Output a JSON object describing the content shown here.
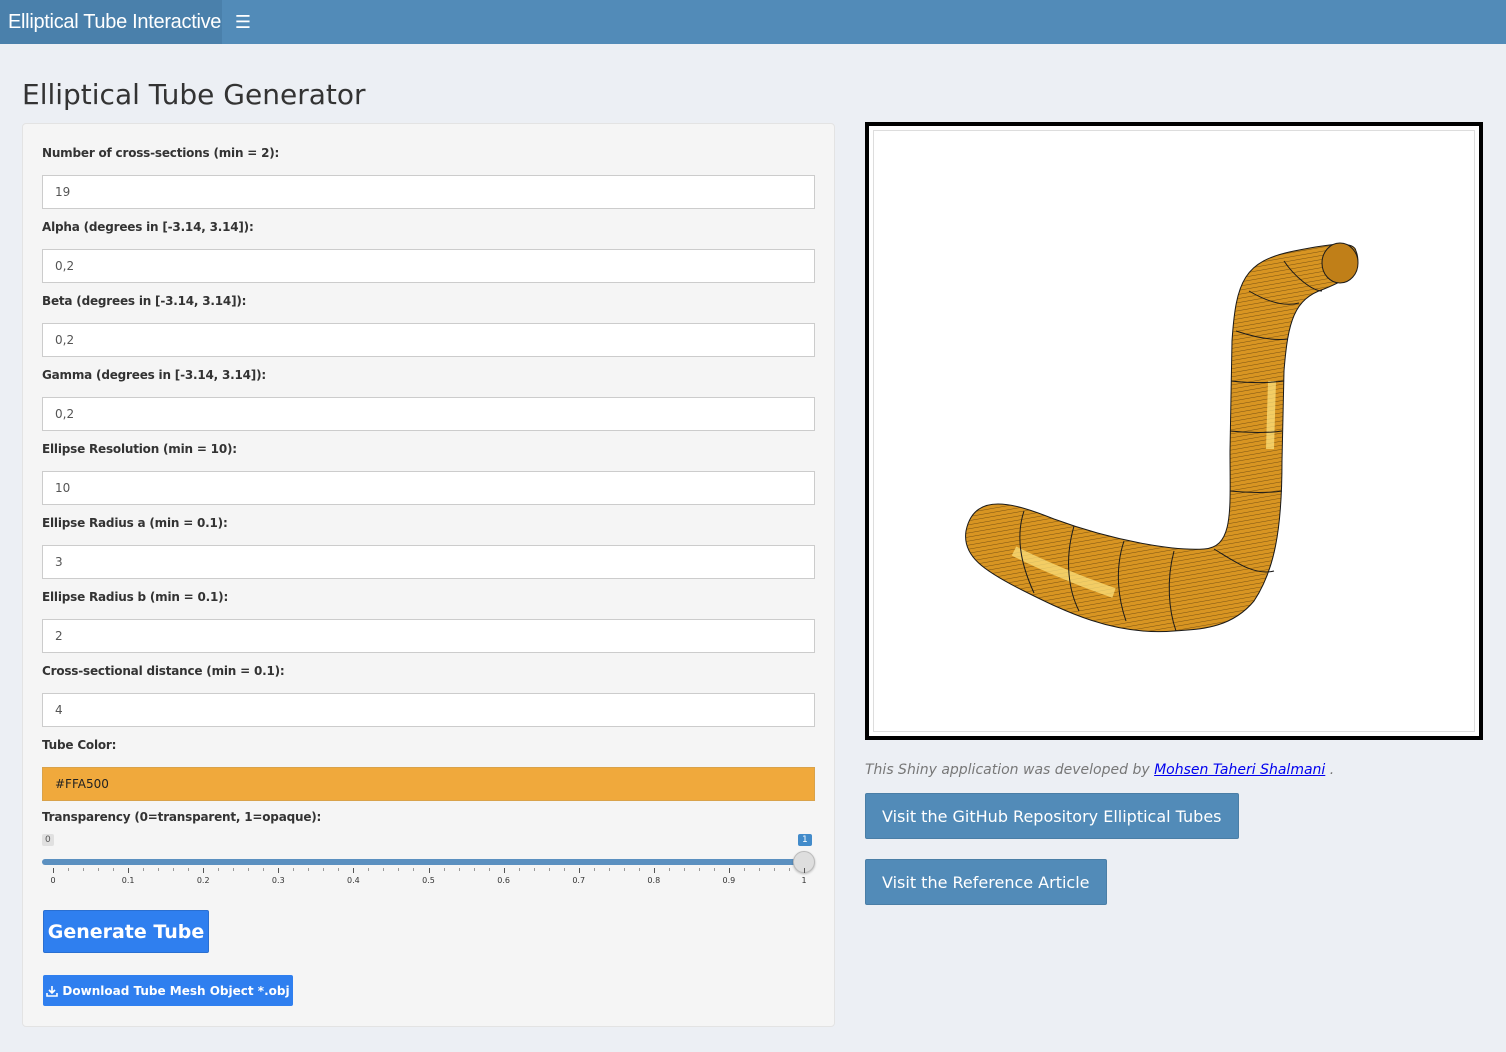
{
  "navbar": {
    "brand": "Elliptical Tube Interactive",
    "menu_icon": "hamburger-icon"
  },
  "page": {
    "title": "Elliptical Tube Generator"
  },
  "form": {
    "fields": [
      {
        "label": "Number of cross-sections (min = 2):",
        "value": "19"
      },
      {
        "label": "Alpha (degrees in [-3.14, 3.14]):",
        "value": "0,2"
      },
      {
        "label": "Beta (degrees in [-3.14, 3.14]):",
        "value": "0,2"
      },
      {
        "label": "Gamma (degrees in [-3.14, 3.14]):",
        "value": "0,2"
      },
      {
        "label": "Ellipse Resolution (min = 10):",
        "value": "10"
      },
      {
        "label": "Ellipse Radius a (min = 0.1):",
        "value": "3"
      },
      {
        "label": "Ellipse Radius b (min = 0.1):",
        "value": "2"
      },
      {
        "label": "Cross-sectional distance (min = 0.1):",
        "value": "4"
      }
    ],
    "color": {
      "label": "Tube Color:",
      "value": "#FFA500",
      "swatch": "#f0a93c"
    },
    "transparency": {
      "label": "Transparency (0=transparent, 1=opaque):",
      "min_label": "0",
      "value": 1,
      "value_label": "1",
      "ticks": [
        "0",
        "0.1",
        "0.2",
        "0.3",
        "0.4",
        "0.5",
        "0.6",
        "0.7",
        "0.8",
        "0.9",
        "1"
      ]
    },
    "generate_label": "Generate Tube",
    "download_label": "Download Tube Mesh Object *.obj",
    "download_icon": "download-icon"
  },
  "viewer": {
    "tube_color": "#d89522"
  },
  "credit": {
    "prefix": "This Shiny application was developed by",
    "author": "Mohsen Taheri Shalmani",
    "suffix": "."
  },
  "links": {
    "github_label": "Visit the GitHub Repository Elliptical Tubes",
    "article_label": "Visit the Reference Article"
  }
}
